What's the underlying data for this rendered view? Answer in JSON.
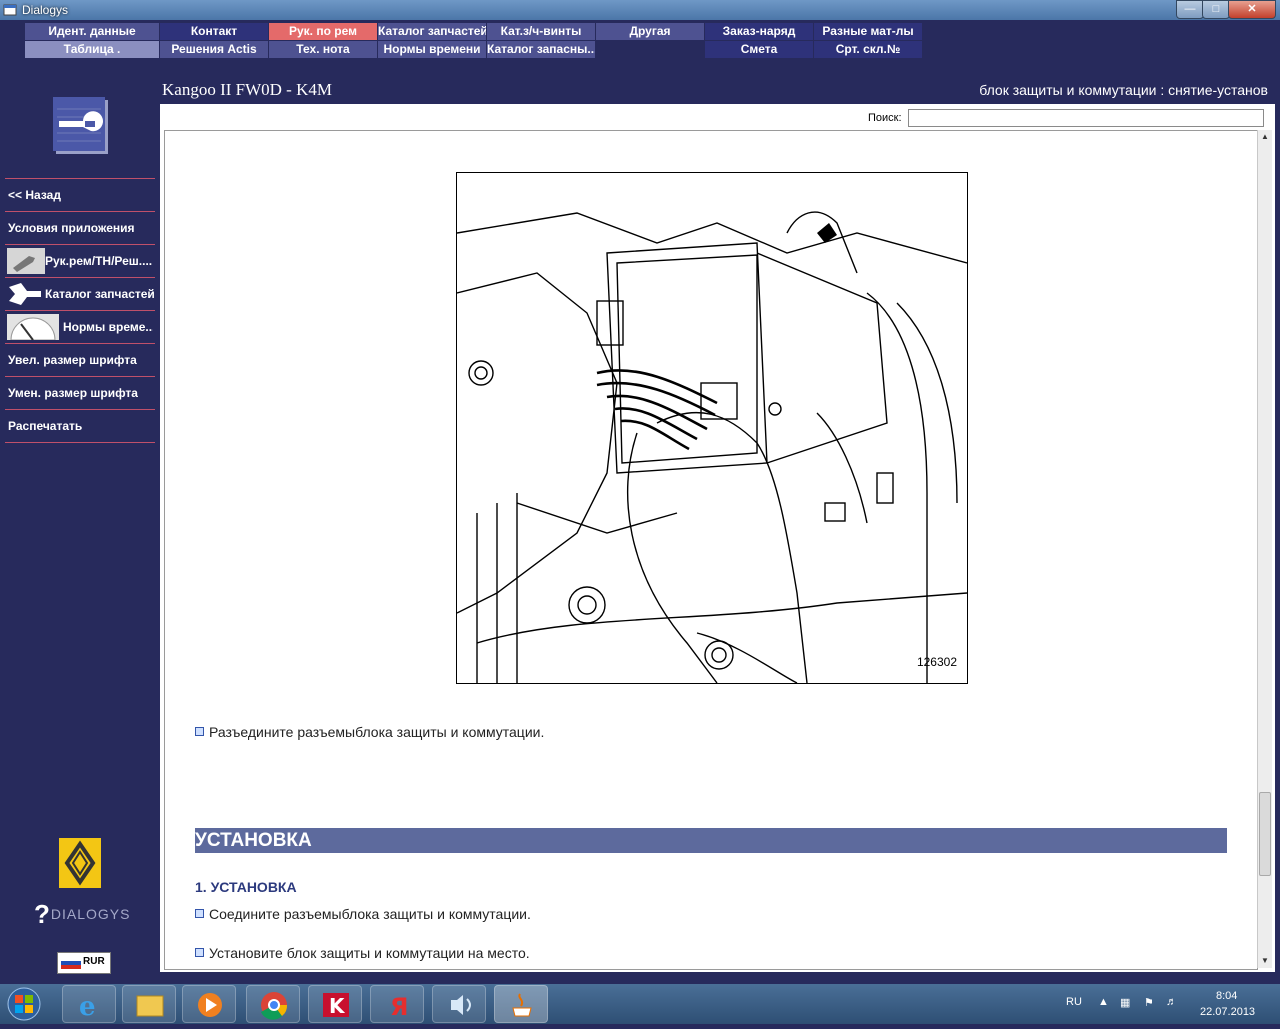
{
  "window": {
    "title": "Dialogys"
  },
  "tabs_row1": [
    "Идент. данные",
    "Контакт",
    "Рук. по рем",
    "Каталог запчастей",
    "Кат.з/ч-винты",
    "Другая",
    "Заказ-наряд",
    "Разные мат-лы"
  ],
  "tabs_row2": [
    "Таблица .",
    "Решения Actis",
    "Тех. нота",
    "Нормы времени",
    "Каталог запасны...",
    "Смета",
    "Срт. скл.№"
  ],
  "doc": {
    "title": "Kangoo II FW0D - K4M",
    "subtitle": "блок защиты и коммутации : снятие-установ"
  },
  "search": {
    "label": "Поиск:",
    "value": ""
  },
  "figure": {
    "number": "126302"
  },
  "content": {
    "step_disconnect": "Разъедините разъемыблока защиты и коммутации.",
    "section_title": "УСТАНОВКА",
    "subsection_title": "1. УСТАНОВКА",
    "step_connect": "Соедините разъемыблока защиты и коммутации.",
    "step_install": "Установите блок защиты и коммутации на место."
  },
  "sidebar": {
    "items": [
      {
        "label": "<< Назад",
        "icon": ""
      },
      {
        "label": "Условия приложения",
        "icon": ""
      },
      {
        "label": "Рук.рем/ТН/Реш....",
        "icon": "wrench-icon"
      },
      {
        "label": "Каталог запчастей",
        "icon": "parts-icon"
      },
      {
        "label": "Нормы време...",
        "icon": "speedometer-icon"
      },
      {
        "label": "Увел. размер шрифта",
        "icon": ""
      },
      {
        "label": "Умен. размер шрифта",
        "icon": ""
      },
      {
        "label": "Распечатать",
        "icon": ""
      }
    ],
    "brand": "DIALOGYS",
    "currency": "RUR"
  },
  "taskbar": {
    "lang": "RU",
    "time": "8:04",
    "date": "22.07.2013",
    "apps": [
      "ie-icon",
      "explorer-icon",
      "media-player-icon",
      "chrome-icon",
      "kaspersky-icon",
      "yandex-icon",
      "sound-icon",
      "java-icon"
    ]
  },
  "colors": {
    "background": "#272a5c",
    "tab_active": "#e46a6a",
    "section_bar": "#5d6a9d",
    "sidebar_divider": "#c0506a"
  }
}
